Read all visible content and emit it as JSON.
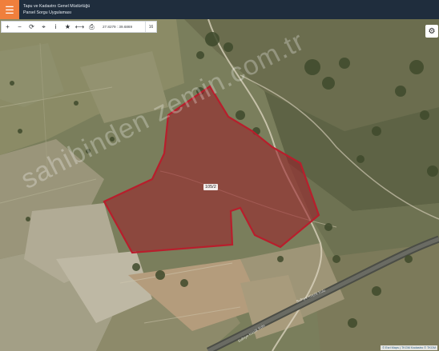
{
  "header": {
    "menu_icon": "hamburger-icon",
    "title_line1": "Tapu ve Kadastro Genel Müdürlüğü",
    "title_line2": "Parsel Sorgu Uygulaması",
    "accent_color": "#f07f3c",
    "bar_color": "#1f2d3d"
  },
  "toolbar": {
    "buttons": [
      {
        "name": "zoom-in",
        "icon": "plus-icon",
        "glyph": "+"
      },
      {
        "name": "zoom-out",
        "icon": "minus-icon",
        "glyph": "−"
      },
      {
        "name": "refresh",
        "icon": "refresh-icon",
        "glyph": "⟳"
      },
      {
        "name": "locate",
        "icon": "crosshair-icon",
        "glyph": "⌖"
      },
      {
        "name": "info",
        "icon": "info-icon",
        "glyph": "i"
      },
      {
        "name": "favorite",
        "icon": "star-icon",
        "glyph": "★"
      },
      {
        "name": "measure",
        "icon": "ruler-icon",
        "glyph": "⟷"
      },
      {
        "name": "print",
        "icon": "print-icon",
        "glyph": "⎙"
      }
    ],
    "coordinates": "27.8279 : 39.6869",
    "zoom_level": "16"
  },
  "settings": {
    "icon": "gear-icon",
    "glyph": "⚙"
  },
  "map": {
    "parcel_label": "105/2",
    "parcel_fill": "#9b1c26",
    "parcel_stroke": "#b81e2c",
    "road_labels": [
      "Sulhiye Küçük Kulu",
      "Sulhiye Küçük Kulu"
    ],
    "watermark": "sahibinden zemin.com.tr",
    "attribution": "© Esri Maps | TKGM Kadastro © TKGM"
  }
}
